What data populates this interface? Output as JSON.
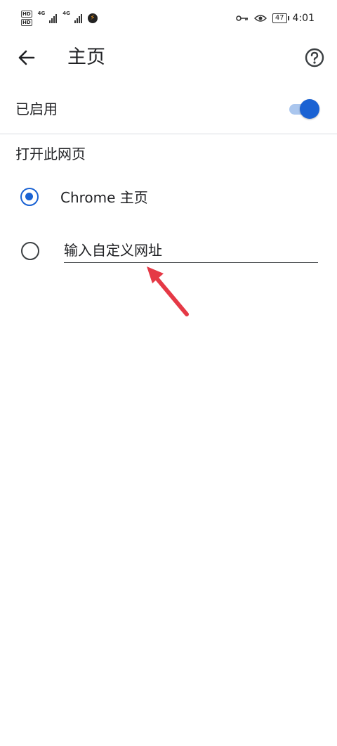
{
  "status_bar": {
    "hd_badges": [
      "HD",
      "HD"
    ],
    "network_types": [
      "4G",
      "4G"
    ],
    "battery_level": "47",
    "time": "4:01"
  },
  "app_bar": {
    "title": "主页",
    "back_icon": "arrow-left-icon",
    "help_icon": "help-circle-icon"
  },
  "toggle": {
    "label": "已启用",
    "enabled": true,
    "accent_color": "#1a62d3"
  },
  "section": {
    "title": "打开此网页"
  },
  "options": {
    "chrome_home": {
      "label": "Chrome 主页",
      "selected": true
    },
    "custom_url": {
      "placeholder": "输入自定义网址",
      "value": "",
      "selected": false
    }
  },
  "annotation": {
    "arrow_color": "#e53946"
  }
}
